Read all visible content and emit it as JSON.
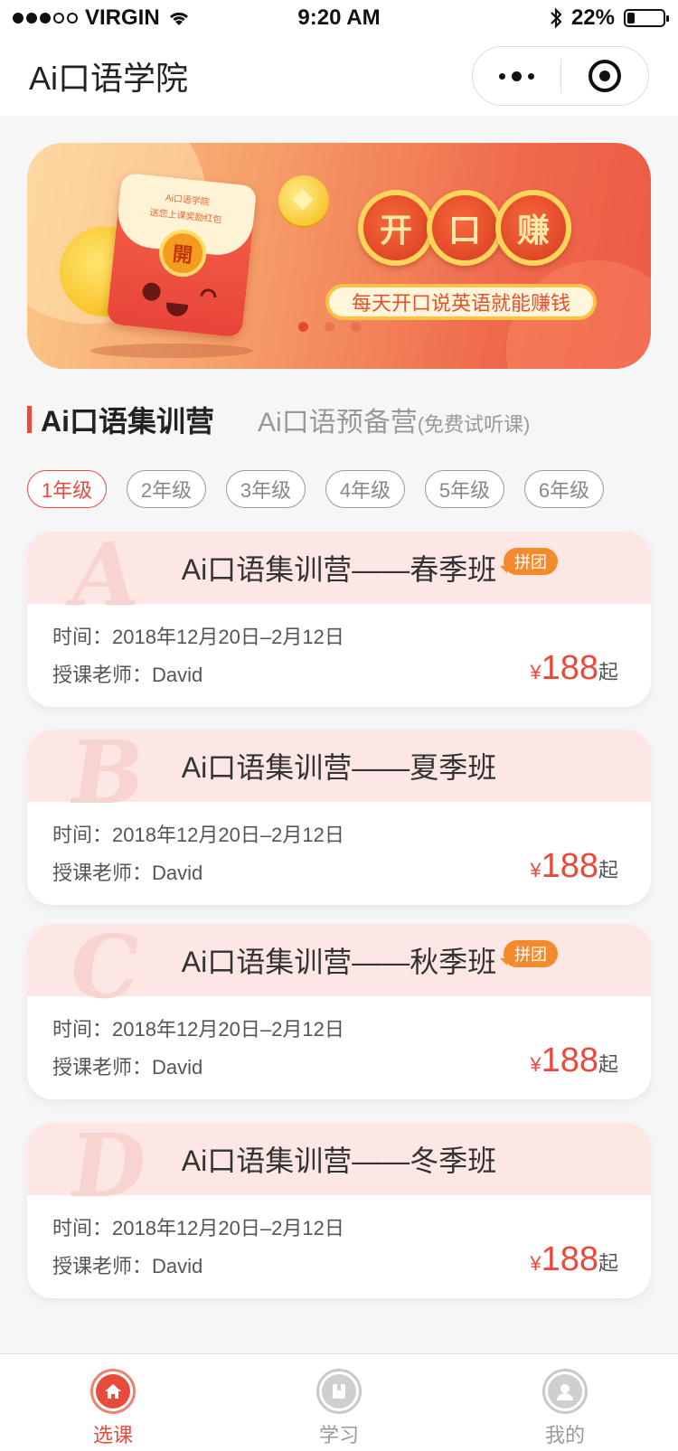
{
  "status_bar": {
    "carrier": "VIRGIN",
    "time": "9:20 AM",
    "battery": "22%",
    "battery_level": 0.22
  },
  "nav": {
    "title": "Ai口语学院"
  },
  "banner": {
    "packet_line1": "Ai口语学院",
    "packet_line2": "送您上课奖励红包",
    "packet_seal": "開",
    "chars": [
      "开",
      "口",
      "赚"
    ],
    "slogan": "每天开口说英语就能赚钱",
    "dots": 3,
    "active_dot": 0
  },
  "tabs": {
    "active": "Ai口语集训营",
    "inactive": "Ai口语预备营",
    "inactive_note": "(免费试听课)"
  },
  "grades": [
    "1年级",
    "2年级",
    "3年级",
    "4年级",
    "5年级",
    "6年级"
  ],
  "selected_grade": 0,
  "courses": [
    {
      "letter": "A",
      "title": "Ai口语集训营——春季班",
      "badge": "拼团",
      "time": "时间：2018年12月20日–2月12日",
      "teacher": "授课老师：David",
      "currency": "¥",
      "price": "188",
      "suffix": "起"
    },
    {
      "letter": "B",
      "title": "Ai口语集训营——夏季班",
      "badge": "",
      "time": "时间：2018年12月20日–2月12日",
      "teacher": "授课老师：David",
      "currency": "¥",
      "price": "188",
      "suffix": "起"
    },
    {
      "letter": "C",
      "title": "Ai口语集训营——秋季班",
      "badge": "拼团",
      "time": "时间：2018年12月20日–2月12日",
      "teacher": "授课老师：David",
      "currency": "¥",
      "price": "188",
      "suffix": "起"
    },
    {
      "letter": "D",
      "title": "Ai口语集训营——冬季班",
      "badge": "",
      "time": "时间：2018年12月20日–2月12日",
      "teacher": "授课老师：David",
      "currency": "¥",
      "price": "188",
      "suffix": "起"
    }
  ],
  "tabbar": [
    {
      "label": "选课",
      "icon": "home-icon",
      "active": true
    },
    {
      "label": "学习",
      "icon": "bookmark-icon",
      "active": false
    },
    {
      "label": "我的",
      "icon": "user-icon",
      "active": false
    }
  ],
  "colors": {
    "accent": "#e84a3c",
    "badge": "#f58a2c",
    "card_header": "#fde7e5"
  }
}
